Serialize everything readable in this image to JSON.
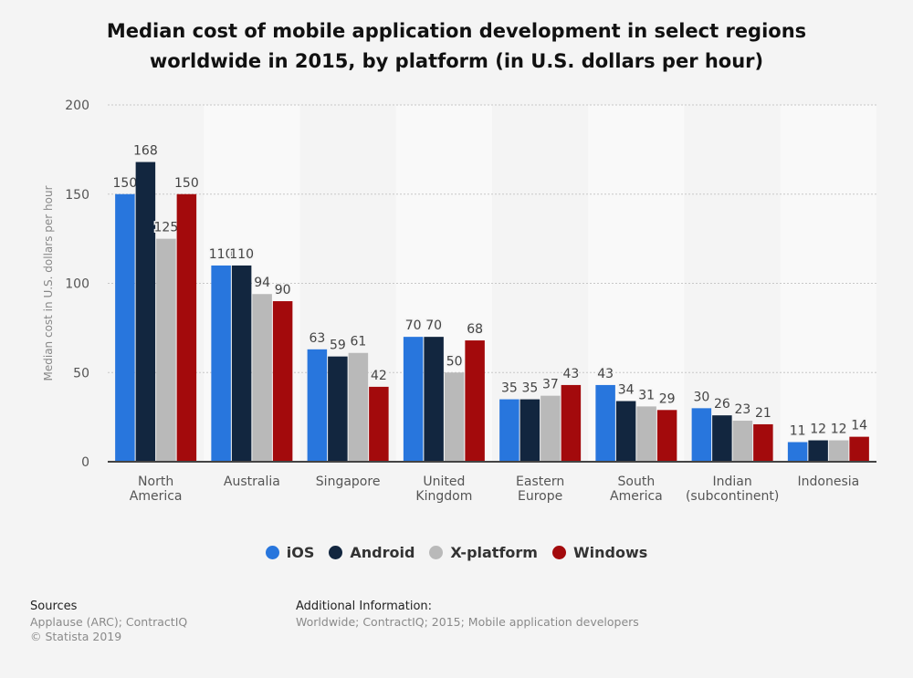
{
  "title_lines": [
    "Median cost of mobile application development in select regions",
    "worldwide in 2015, by platform (in U.S. dollars per hour)"
  ],
  "chart_data": {
    "type": "bar",
    "title": "Median cost of mobile application development in select regions worldwide in 2015, by platform (in U.S. dollars per hour)",
    "xlabel": "",
    "ylabel": "Median cost in U.S. dollars per hour",
    "ylim": [
      0,
      200
    ],
    "yticks": [
      0,
      50,
      100,
      150,
      200
    ],
    "grid": true,
    "legend_position": "bottom",
    "categories": [
      [
        "North",
        "America"
      ],
      [
        "Australia"
      ],
      [
        "Singapore"
      ],
      [
        "United",
        "Kingdom"
      ],
      [
        "Eastern",
        "Europe"
      ],
      [
        "South",
        "America"
      ],
      [
        "Indian",
        "(subcontinent)"
      ],
      [
        "Indonesia"
      ]
    ],
    "series": [
      {
        "name": "iOS",
        "color": "#2876dd",
        "values": [
          150,
          110,
          63,
          70,
          35,
          43,
          30,
          11
        ]
      },
      {
        "name": "Android",
        "color": "#12263f",
        "values": [
          168,
          110,
          59,
          70,
          35,
          34,
          26,
          12
        ]
      },
      {
        "name": "X-platform",
        "color": "#b9b9b9",
        "values": [
          125,
          94,
          61,
          50,
          37,
          31,
          23,
          12
        ]
      },
      {
        "name": "Windows",
        "color": "#a30a0c",
        "values": [
          150,
          90,
          42,
          68,
          43,
          29,
          21,
          14
        ]
      }
    ]
  },
  "footer": {
    "sources_heading": "Sources",
    "sources_line1": "Applause (ARC); ContractIQ",
    "sources_line2": "© Statista 2019",
    "additional_heading": "Additional Information:",
    "additional_text": "Worldwide; ContractIQ; 2015; Mobile application developers"
  }
}
